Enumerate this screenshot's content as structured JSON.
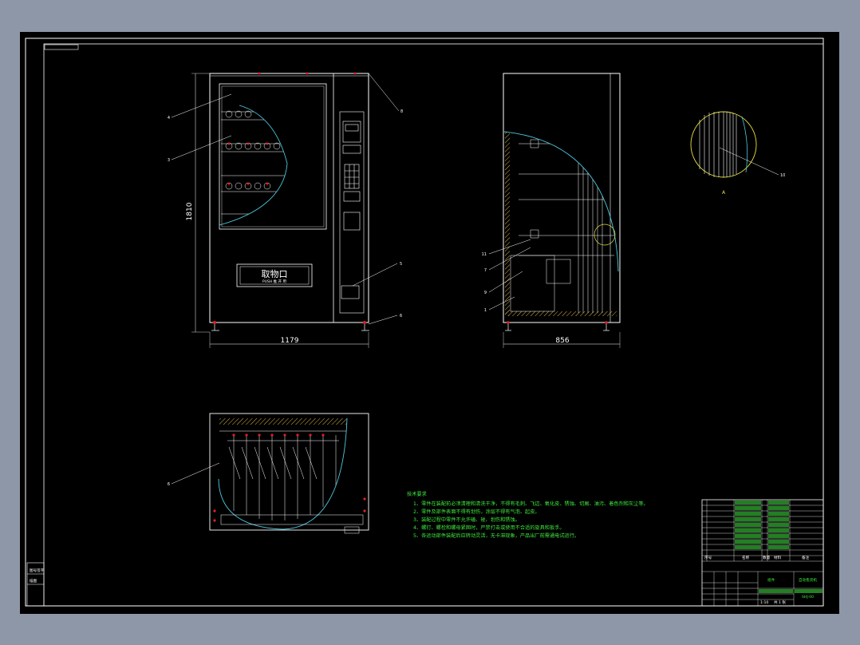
{
  "dims": {
    "front_height": "1810",
    "front_width": "1179",
    "side_depth": "856"
  },
  "pickup_window": {
    "label": "取物口",
    "sublabel": "PUSH 推 开 用"
  },
  "callouts": {
    "front": [
      "4",
      "3",
      "8",
      "5",
      "6"
    ],
    "side": [
      "11",
      "7",
      "9",
      "1"
    ],
    "bottom": [
      "6"
    ],
    "detail_marker": "10",
    "detail_name": "A"
  },
  "tech_notes": {
    "title": "技术要求",
    "items": [
      "1、零件在装配前必须清理和清洗干净，不得有毛刺、飞边、氧化皮、锈蚀、切屑、油污、着色剂和灰尘等。",
      "2、零件及部件表面不得有划伤，涂层不得有气泡、起皮。",
      "3、装配过程中零件不允许磕、碰、划伤和锈蚀。",
      "4、螺钉、螺栓和螺母紧固时，严禁打击或使用不合适的旋具和扳手。",
      "5、各运动部件装配后应转动灵活，无卡滞现象，产品出厂前需通电试运行。"
    ]
  },
  "title_block": {
    "drawing_title": "自动售货机",
    "material": "组件",
    "col_seq": "序号",
    "col_name": "名称",
    "col_qty": "数量",
    "col_mat": "材料",
    "col_note": "备注",
    "scale": "1:10",
    "sheet": "共 1 张",
    "drawing_no": "SHJ-00"
  },
  "side_label": {
    "line1": "图号签字",
    "line2": "描图"
  }
}
